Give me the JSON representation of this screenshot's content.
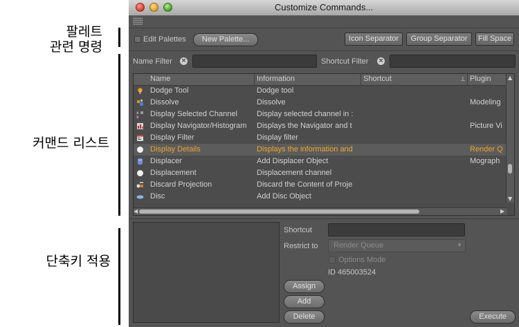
{
  "annotations": {
    "palette_line1": "팔레트",
    "palette_line2": "관련 명령",
    "command_list": "커맨드 리스트",
    "shortcut_apply": "단축키 적용"
  },
  "window": {
    "title": "Customize Commands..."
  },
  "toolbar": {
    "edit_palettes": "Edit Palettes",
    "new_palette": "New Palette...",
    "icon_separator": "Icon Separator",
    "group_separator": "Group Separator",
    "fill_space": "Fill Space"
  },
  "filters": {
    "name_filter": "Name Filter",
    "shortcut_filter": "Shortcut Filter"
  },
  "table": {
    "columns": [
      "Name",
      "Information",
      "Shortcut",
      "Plugin"
    ],
    "rows": [
      {
        "name": "Dodge Tool",
        "info": "Dodge tool",
        "shortcut": "",
        "plugin": "",
        "icon": "dodge-tool-icon",
        "selected": false
      },
      {
        "name": "Dissolve",
        "info": "Dissolve",
        "shortcut": "",
        "plugin": "Modeling",
        "icon": "dissolve-icon",
        "selected": false
      },
      {
        "name": "Display Selected Channel",
        "info": "Display selected channel in :",
        "shortcut": "",
        "plugin": "",
        "icon": "channel-icon",
        "selected": false
      },
      {
        "name": "Display Navigator/Histogram",
        "info": "Displays the Navigator and t",
        "shortcut": "",
        "plugin": "Picture Vi",
        "icon": "navigator-icon",
        "selected": false
      },
      {
        "name": "Display Filter",
        "info": "Display filter",
        "shortcut": "",
        "plugin": "",
        "icon": "filter-icon",
        "selected": false
      },
      {
        "name": "Display Details",
        "info": "Displays the information and",
        "shortcut": "",
        "plugin": "Render Q",
        "icon": "details-icon",
        "selected": true
      },
      {
        "name": "Displacer",
        "info": "Add Displacer Object",
        "shortcut": "",
        "plugin": "Mograph",
        "icon": "displacer-icon",
        "selected": false
      },
      {
        "name": "Displacement",
        "info": "Displacement channel",
        "shortcut": "",
        "plugin": "",
        "icon": "displacement-icon",
        "selected": false
      },
      {
        "name": "Discard Projection",
        "info": "Discard the Content of Proje",
        "shortcut": "",
        "plugin": "",
        "icon": "projection-icon",
        "selected": false
      },
      {
        "name": "Disc",
        "info": "Add Disc Object",
        "shortcut": "",
        "plugin": "",
        "icon": "disc-icon",
        "selected": false
      }
    ]
  },
  "shortcut_panel": {
    "shortcut_label": "Shortcut",
    "restrict_label": "Restrict to",
    "restrict_value": "Render Queue",
    "options_mode": "Options Mode",
    "id_text": "ID 465003524",
    "assign": "Assign",
    "add": "Add",
    "delete": "Delete",
    "execute": "Execute"
  },
  "colors": {
    "selected_text": "#f0a528",
    "window_bg": "#545454"
  }
}
